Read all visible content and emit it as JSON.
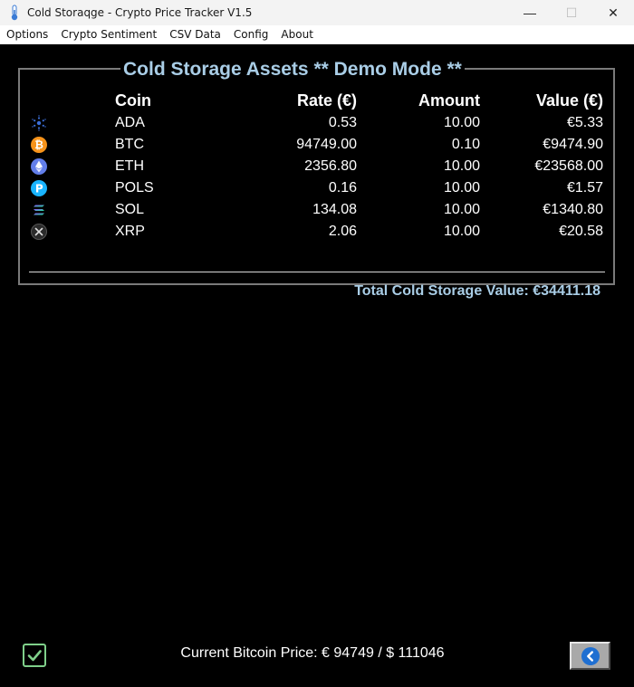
{
  "window": {
    "title": "Cold Storaqge - Crypto Price Tracker V1.5",
    "minimize_glyph": "—",
    "maximize_glyph": "☐",
    "close_glyph": "✕"
  },
  "menu": [
    "Options",
    "Crypto Sentiment",
    "CSV Data",
    "Config",
    "About"
  ],
  "panel": {
    "title": "Cold Storage Assets ** Demo Mode **",
    "headers": {
      "coin": "Coin",
      "rate": "Rate (€)",
      "amount": "Amount",
      "value": "Value (€)"
    },
    "rows": [
      {
        "icon": "cardano-icon",
        "coin": "ADA",
        "rate": "0.53",
        "amount": "10.00",
        "value": "€5.33"
      },
      {
        "icon": "bitcoin-icon",
        "coin": "BTC",
        "rate": "94749.00",
        "amount": "0.10",
        "value": "€9474.90"
      },
      {
        "icon": "ethereum-icon",
        "coin": "ETH",
        "rate": "2356.80",
        "amount": "10.00",
        "value": "€23568.00"
      },
      {
        "icon": "polkastarter-icon",
        "coin": "POLS",
        "rate": "0.16",
        "amount": "10.00",
        "value": "€1.57"
      },
      {
        "icon": "solana-icon",
        "coin": "SOL",
        "rate": "134.08",
        "amount": "10.00",
        "value": "€1340.80"
      },
      {
        "icon": "xrp-icon",
        "coin": "XRP",
        "rate": "2.06",
        "amount": "10.00",
        "value": "€20.58"
      }
    ],
    "total": "Total Cold Storage Value: €34411.18"
  },
  "footer": {
    "bitcoin_price": "Current Bitcoin Price: € 94749 / $ 111046"
  },
  "colors": {
    "accent": "#a9cde6",
    "check": "#7fd08a",
    "back_button_icon": "#1f6fd1"
  }
}
